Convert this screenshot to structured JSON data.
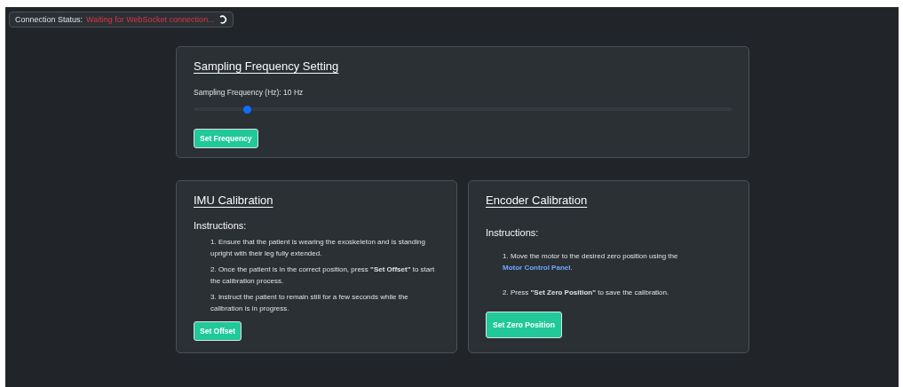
{
  "connection_status": {
    "label": "Connection Status:",
    "value": "Waiting for WebSocket connection..."
  },
  "sampling": {
    "title": "Sampling Frequency Setting",
    "slider_label": "Sampling Frequency (Hz): 10 Hz",
    "slider": {
      "level": 0.1
    },
    "button": "Set Frequency"
  },
  "imu_calibration": {
    "title": "IMU Calibration",
    "subtitle": "Instructions:",
    "steps": [
      {
        "text": "1. Ensure that the patient is wearing the exoskeleton and is standing upright with their leg fully extended."
      },
      {
        "text": "2. Once the patient is in the correct position, press **\"Set Offset\"** to start the calibration process."
      },
      {
        "text": "3. Instruct the patient to remain still for a few seconds while the calibration is in progress."
      }
    ],
    "button": "Set Offset"
  },
  "encoder_calibration": {
    "title": "Encoder Calibration",
    "subtitle": "Instructions:",
    "steps": [
      {
        "text": "1. Move the motor to the desired zero position using the ",
        "link": "Motor Control Panel",
        "after": "."
      },
      {
        "text": "2. Press **\"Set Zero Position\"** to save the calibration."
      }
    ],
    "button": "Set Zero Position"
  }
}
